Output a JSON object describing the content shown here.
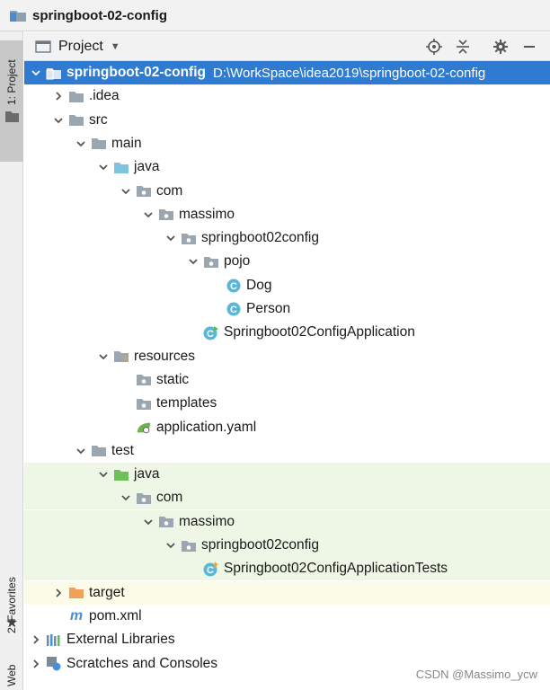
{
  "window": {
    "title": "springboot-02-config"
  },
  "left_strip": {
    "project_tab": "1: Project",
    "favorites_tab": "2: Favorites",
    "web_tab": "Web"
  },
  "panel": {
    "title": "Project",
    "icons": [
      "crosshair-icon",
      "collapse-icon",
      "gear-icon",
      "minimize-icon"
    ]
  },
  "tree": [
    {
      "label": "springboot-02-config",
      "path": "D:\\WorkSpace\\idea2019\\springboot-02-config",
      "icon": "module-folder-icon",
      "expanded": true
    },
    {
      "label": ".idea",
      "icon": "folder-icon",
      "expanded": false
    },
    {
      "label": "src",
      "icon": "folder-icon",
      "expanded": true
    },
    {
      "label": "main",
      "icon": "folder-icon",
      "expanded": true
    },
    {
      "label": "java",
      "icon": "source-folder-icon",
      "expanded": true
    },
    {
      "label": "com",
      "icon": "package-icon",
      "expanded": true
    },
    {
      "label": "massimo",
      "icon": "package-icon",
      "expanded": true
    },
    {
      "label": "springboot02config",
      "icon": "package-icon",
      "expanded": true
    },
    {
      "label": "pojo",
      "icon": "package-icon",
      "expanded": true
    },
    {
      "label": "Dog",
      "icon": "class-icon"
    },
    {
      "label": "Person",
      "icon": "class-icon"
    },
    {
      "label": "Springboot02ConfigApplication",
      "icon": "spring-boot-class-icon"
    },
    {
      "label": "resources",
      "icon": "resources-folder-icon",
      "expanded": true
    },
    {
      "label": "static",
      "icon": "package-icon"
    },
    {
      "label": "templates",
      "icon": "package-icon"
    },
    {
      "label": "application.yaml",
      "icon": "spring-config-icon"
    },
    {
      "label": "test",
      "icon": "folder-icon",
      "expanded": true
    },
    {
      "label": "java",
      "icon": "test-source-folder-icon",
      "expanded": true
    },
    {
      "label": "com",
      "icon": "package-icon",
      "expanded": true
    },
    {
      "label": "massimo",
      "icon": "package-icon",
      "expanded": true
    },
    {
      "label": "springboot02config",
      "icon": "package-icon",
      "expanded": true
    },
    {
      "label": "Springboot02ConfigApplicationTests",
      "icon": "test-class-icon"
    },
    {
      "label": "target",
      "icon": "excluded-folder-icon",
      "expanded": false
    },
    {
      "label": "pom.xml",
      "icon": "maven-icon"
    },
    {
      "label": "External Libraries",
      "icon": "libraries-icon",
      "expanded": false
    },
    {
      "label": "Scratches and Consoles",
      "icon": "scratches-icon",
      "expanded": false
    }
  ],
  "watermark": "CSDN @Massimo_ycw",
  "colors": {
    "selection": "#2f7bd1",
    "folder": "#9aa7b0",
    "source_folder": "#7fc4dc",
    "test_folder": "#6fbf5b",
    "excluded_folder": "#f0a05a",
    "class": "#5bb7d8"
  }
}
